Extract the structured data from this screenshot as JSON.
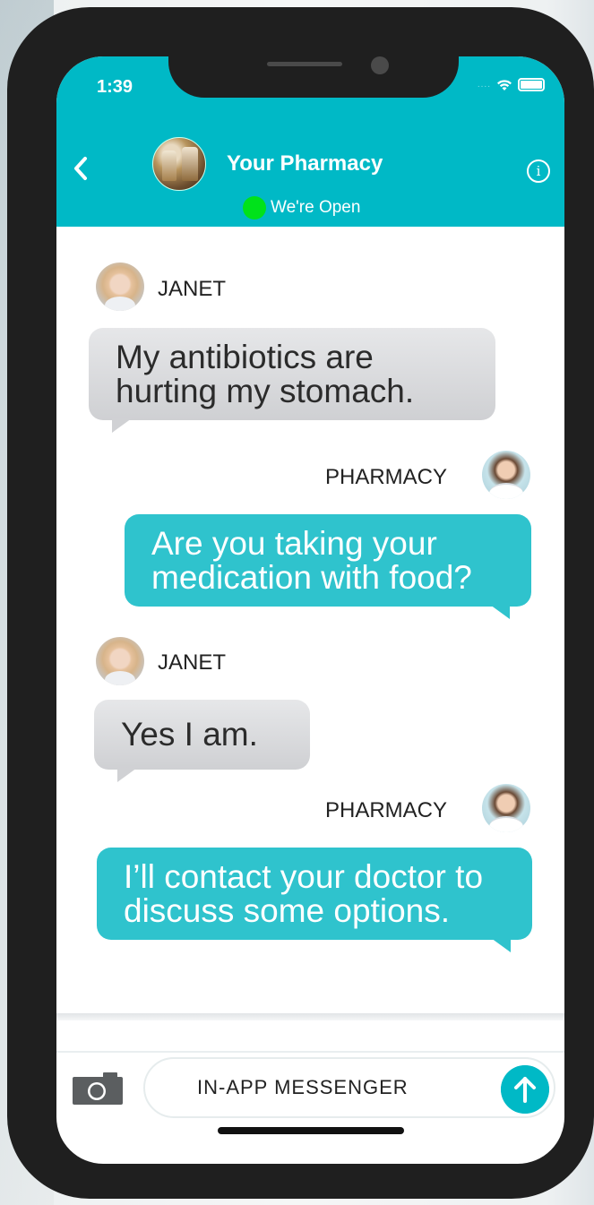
{
  "status_bar": {
    "time": "1:39",
    "signal": "....",
    "wifi_icon": "wifi-icon",
    "battery_icon": "battery-icon"
  },
  "header": {
    "back_icon": "chevron-left-icon",
    "title": "Your Pharmacy",
    "status_text": "We're Open",
    "status_color": "#00e21b",
    "info_icon": "info-icon",
    "info_glyph": "i",
    "background": "#00b9c6"
  },
  "messages": [
    {
      "sender": "JANET",
      "side": "left",
      "text_lines": [
        "My antibiotics are",
        "hurting my stomach."
      ]
    },
    {
      "sender": "PHARMACY",
      "side": "right",
      "text_lines": [
        "Are you taking your",
        "medication with food?"
      ]
    },
    {
      "sender": "JANET",
      "side": "left",
      "text_lines": [
        "Yes I am."
      ]
    },
    {
      "sender": "PHARMACY",
      "side": "right",
      "text_lines": [
        "I’ll contact your doctor to",
        "discuss some options."
      ]
    }
  ],
  "composer": {
    "camera_icon": "camera-icon",
    "placeholder": "IN-APP MESSENGER",
    "send_icon": "arrow-up-icon"
  }
}
